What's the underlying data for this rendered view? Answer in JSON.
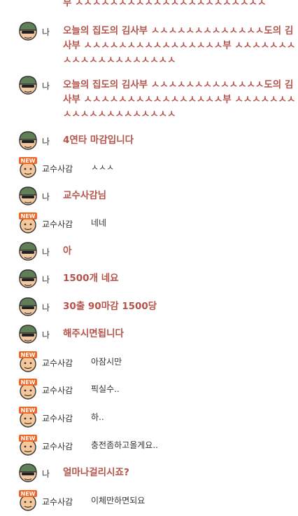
{
  "sender_me": "나",
  "sender_other": "교수사감",
  "top_fragment": "부 ㅅㅅㅅㅅㅅㅅㅅㅅㅅㅅㅅㅅㅅㅅㅅㅅㅅㅅㅅㅅㅅㅅ",
  "messages": [
    {
      "from": "me",
      "text": "오늘의 집도의 김사부 ㅅㅅㅅㅅㅅㅅㅅㅅㅅㅅㅅㅅㅅ도의 김사부 ㅅㅅㅅㅅㅅㅅㅅㅅㅅㅅㅅㅅㅅㅅㅅㅅ부 ㅅㅅㅅㅅㅅㅅㅅㅅㅅㅅㅅㅅㅅㅅㅅㅅㅅㅅㅅㅅ"
    },
    {
      "from": "me",
      "text": "오늘의 집도의 김사부 ㅅㅅㅅㅅㅅㅅㅅㅅㅅㅅㅅㅅㅅ도의 김사부 ㅅㅅㅅㅅㅅㅅㅅㅅㅅㅅㅅㅅㅅㅅㅅㅅ부 ㅅㅅㅅㅅㅅㅅㅅㅅㅅㅅㅅㅅㅅㅅㅅㅅㅅㅅㅅㅅ"
    },
    {
      "from": "me",
      "text": "4연타 마감입니다"
    },
    {
      "from": "other",
      "text": "ㅅㅅㅅ"
    },
    {
      "from": "me",
      "text": "교수사감님"
    },
    {
      "from": "other",
      "text": "네네"
    },
    {
      "from": "me",
      "text": "아"
    },
    {
      "from": "me",
      "text": "1500개 네요"
    },
    {
      "from": "me",
      "text": "30출 90마감 1500당"
    },
    {
      "from": "me",
      "text": "해주시면됩니다"
    },
    {
      "from": "other",
      "text": "아잠시만"
    },
    {
      "from": "other",
      "text": "픽실수.."
    },
    {
      "from": "other",
      "text": "하.."
    },
    {
      "from": "other",
      "text": "충전좀하고올게요.."
    },
    {
      "from": "me",
      "text": "얼마나걸리시죠?"
    },
    {
      "from": "other",
      "text": "이체만하면되요"
    }
  ]
}
